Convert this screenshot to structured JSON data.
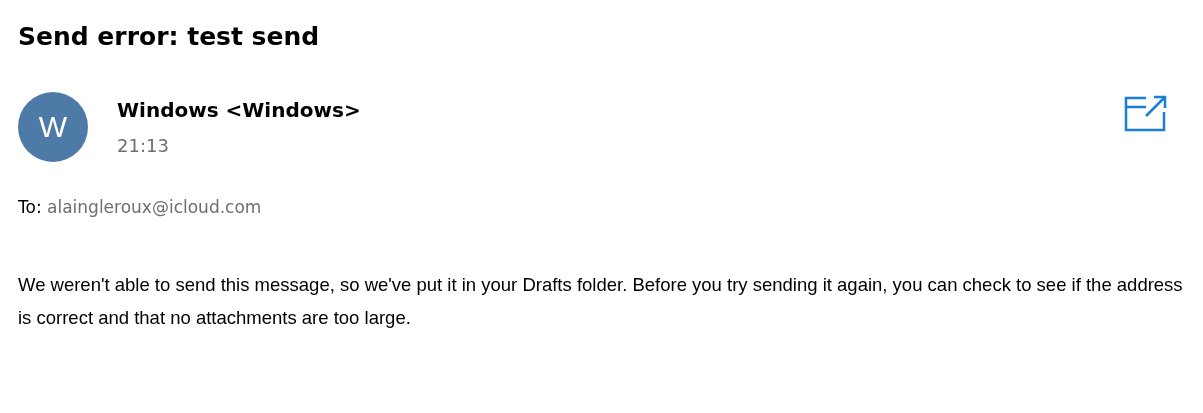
{
  "message": {
    "subject": "Send error: test send",
    "sender": {
      "avatar_letter": "W",
      "name": "Windows <Windows>",
      "time": "21:13"
    },
    "to": {
      "label": "To:",
      "address": "alaingleroux@icloud.com"
    },
    "body": "We weren't able to send this message, so we've put it in your Drafts folder. Before you try sending it again, you can check to see if the address is correct and that no attachments are too large."
  }
}
